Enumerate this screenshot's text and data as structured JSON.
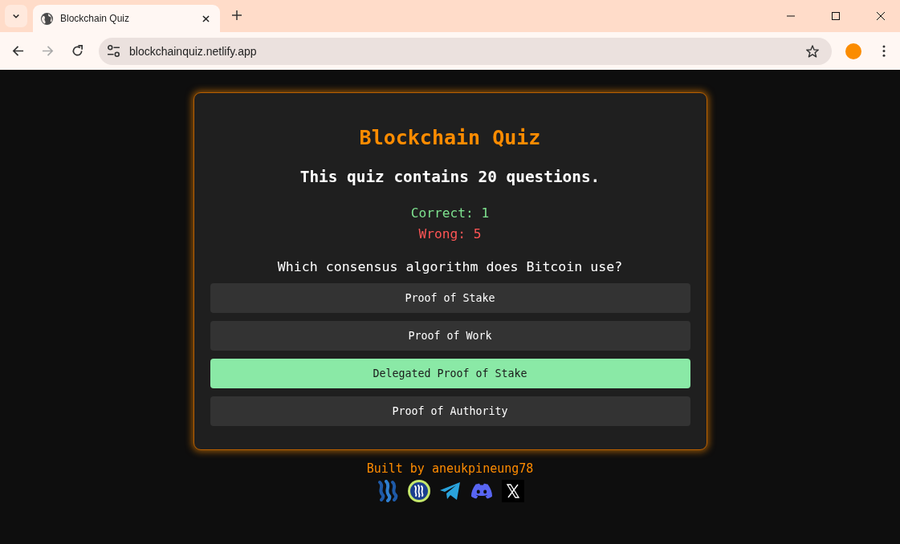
{
  "browser": {
    "tab": {
      "title": "Blockchain Quiz"
    },
    "address": "blockchainquiz.netlify.app"
  },
  "quiz": {
    "title": "Blockchain Quiz",
    "subtitle": "This quiz contains 20 questions.",
    "score": {
      "correct": "Correct: 1",
      "wrong": "Wrong: 5"
    },
    "question": "Which consensus algorithm does Bitcoin use?",
    "options": [
      {
        "label": "Proof of Stake",
        "selected": false
      },
      {
        "label": "Proof of Work",
        "selected": false
      },
      {
        "label": "Delegated Proof of Stake",
        "selected": true
      },
      {
        "label": "Proof of Authority",
        "selected": false
      }
    ]
  },
  "footer": {
    "credit": "Built by aneukpineung78"
  }
}
